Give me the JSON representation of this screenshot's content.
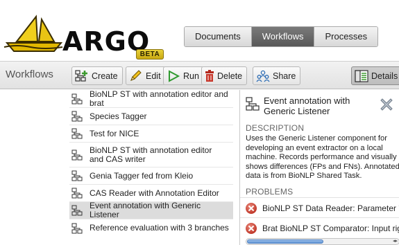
{
  "app": {
    "logo_text": "ARGO",
    "beta_label": "BETA"
  },
  "nav": {
    "tabs": [
      {
        "label": "Documents",
        "active": false
      },
      {
        "label": "Workflows",
        "active": true
      },
      {
        "label": "Processes",
        "active": false
      }
    ]
  },
  "toolbar": {
    "title": "Workflows",
    "create_label": "Create",
    "edit_label": "Edit",
    "run_label": "Run",
    "delete_label": "Delete",
    "share_label": "Share",
    "details_label": "Details",
    "details_pressed": true
  },
  "workflows": {
    "items": [
      {
        "label": "BioNLP ST with annotation editor and brat",
        "selected": false
      },
      {
        "label": "Species Tagger",
        "selected": false
      },
      {
        "label": "Test for NICE",
        "selected": false
      },
      {
        "label": "BioNLP ST with annotation editor and CAS writer",
        "selected": false
      },
      {
        "label": "Genia Tagger fed from Kleio",
        "selected": false
      },
      {
        "label": "CAS Reader with Annotation Editor",
        "selected": false
      },
      {
        "label": "Event annotation with Generic Listener",
        "selected": true
      },
      {
        "label": "Reference evaluation with 3 branches",
        "selected": false
      }
    ]
  },
  "details": {
    "title": "Event annotation with Generic Listener",
    "description_heading": "DESCRIPTION",
    "description": "Uses the Generic Listener component for developing an event extractor on a local machine. Records performance and visually shows differences (FPs and FNs). Annotated data is from BioNLP Shared Task.",
    "problems_heading": "PROBLEMS",
    "problems": [
      "BioNLP ST Data Reader: Parameter \"fol",
      "Brat BioNLP ST Comparator: Input right"
    ]
  },
  "colors": {
    "nav_active": "#666666",
    "error": "#c0392b",
    "selected_row": "#dcdcdc",
    "scroll_thumb": "#5f93d3",
    "logo_yellow": "#e6c200"
  },
  "icons": {
    "create": "workflow-add-icon",
    "edit": "pencil-icon",
    "run": "play-icon",
    "delete": "trash-icon",
    "share": "users-share-icon",
    "details": "details-panel-icon",
    "workflow": "workflow-icon",
    "close": "close-x-icon",
    "error": "error-icon"
  }
}
